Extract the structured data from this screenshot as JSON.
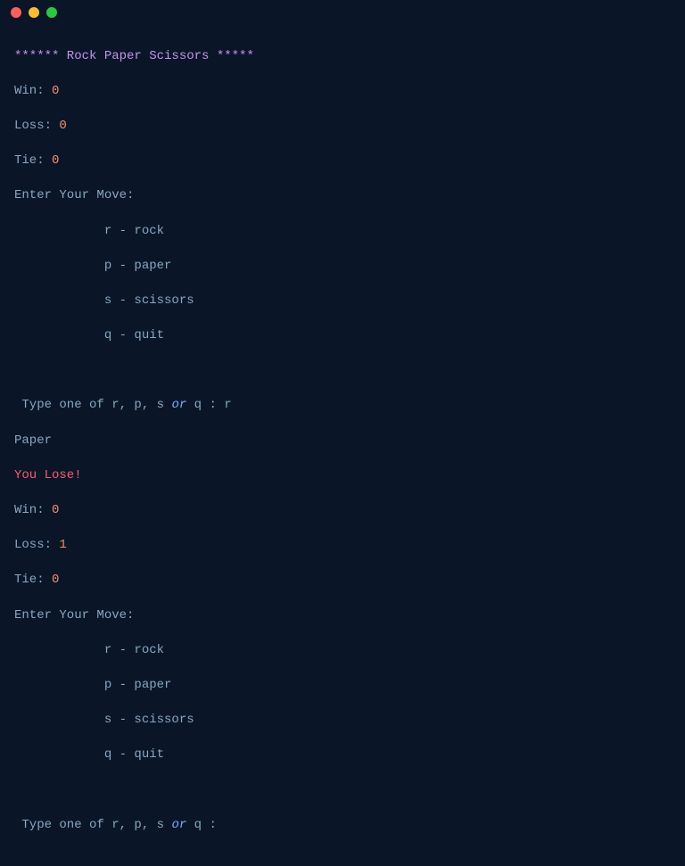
{
  "title_line": "****** Rock Paper Scissors *****",
  "labels": {
    "win": "Win: ",
    "loss": "Loss: ",
    "tie": "Tie: ",
    "enter_move": "Enter Your Move:",
    "prompt_prefix": " Type one of r, p, s ",
    "or": "or",
    "prompt_suffix": " q : "
  },
  "options": {
    "r": "            r - rock",
    "p": "            p - paper",
    "s": "            s - scissors",
    "q": "            q - quit"
  },
  "round1": {
    "win": "0",
    "loss": "0",
    "tie": "0",
    "input": "r",
    "computer_move": "Paper",
    "result": "You Lose!"
  },
  "round2": {
    "win": "0",
    "loss": "1",
    "tie": "0",
    "input": ""
  }
}
